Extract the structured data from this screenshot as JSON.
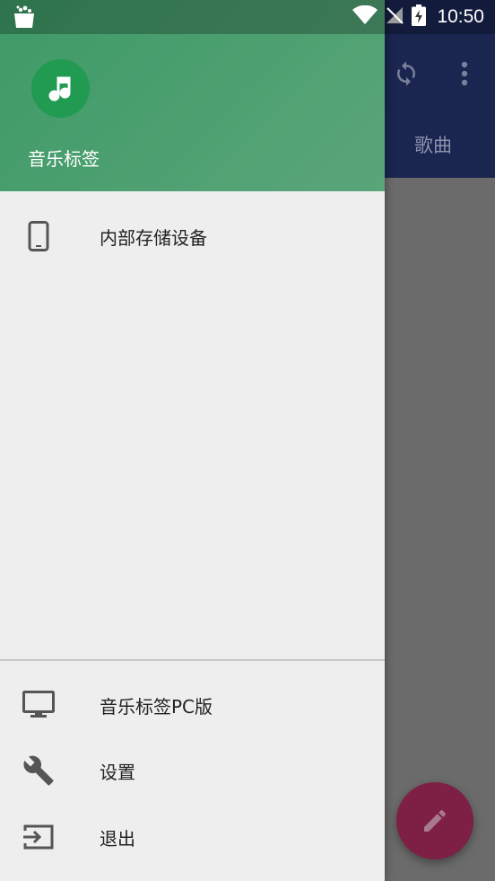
{
  "status_bar": {
    "time": "10:50"
  },
  "background_app": {
    "tab_label": "歌曲"
  },
  "drawer": {
    "app_name": "音乐标签",
    "primary_items": [
      {
        "label": "内部存储设备",
        "icon": "phone-icon"
      }
    ],
    "secondary_items": [
      {
        "label": "音乐标签PC版",
        "icon": "monitor-icon"
      },
      {
        "label": "设置",
        "icon": "wrench-icon"
      },
      {
        "label": "退出",
        "icon": "exit-icon"
      }
    ]
  },
  "colors": {
    "drawer_header": "#3e9a66",
    "avatar": "#219a52",
    "toolbar_dimmed": "#1a2550",
    "fab_dimmed": "#7e1f45"
  }
}
